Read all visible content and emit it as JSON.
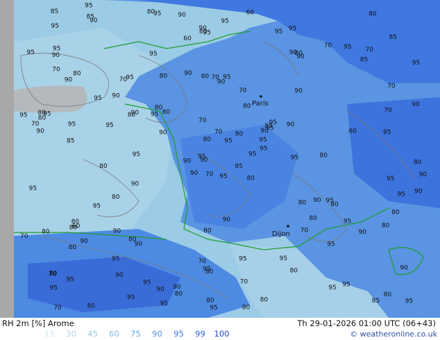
{
  "map": {
    "city": {
      "name": "Paris"
    },
    "city2": {
      "name": "Dijon"
    },
    "contour_labels": [
      "95",
      "90",
      "90",
      "80",
      "90",
      "90",
      "95",
      "95",
      "80",
      "95",
      "90",
      "95",
      "85",
      "95",
      "90",
      "90",
      "80",
      "80",
      "80",
      "90",
      "80",
      "95",
      "90",
      "70",
      "95",
      "80",
      "80",
      "95",
      "90",
      "80",
      "90",
      "95",
      "70",
      "80",
      "95",
      "70",
      "80",
      "85",
      "90",
      "95",
      "60",
      "95",
      "95",
      "70",
      "95",
      "95",
      "95",
      "70",
      "80",
      "95",
      "80",
      "70",
      "95",
      "80",
      "80",
      "95",
      "85",
      "85",
      "95",
      "70",
      "95",
      "95",
      "95",
      "90",
      "95",
      "95",
      "95",
      "60",
      "70",
      "70",
      "80",
      "90",
      "90",
      "80",
      "70",
      "95",
      "95",
      "95",
      "70",
      "70",
      "80",
      "95",
      "95",
      "80",
      "80",
      "95",
      "90",
      "95",
      "80",
      "95",
      "90",
      "90",
      "90",
      "95",
      "95",
      "80",
      "80",
      "95",
      "90",
      "90",
      "80",
      "80",
      "80",
      "70",
      "95",
      "90",
      "95",
      "85",
      "85",
      "90",
      "95",
      "90",
      "90",
      "90",
      "95",
      "80",
      "70",
      "85",
      "90",
      "90",
      "80",
      "80",
      "70",
      "80",
      "80",
      "80",
      "80",
      "80",
      "60",
      "70",
      "60",
      "80",
      "90",
      "95",
      "95",
      "95",
      "90",
      "80",
      "90",
      "80",
      "80",
      "95",
      "90",
      "95",
      "95",
      "95",
      "90",
      "95",
      "95",
      "80",
      "70",
      "70",
      "80",
      "95"
    ]
  },
  "footer": {
    "title": "RH 2m [%] Arome",
    "datetime": "Th 29-01-2026 01:00 UTC (06+43)",
    "credit": "© weatheronline.co.uk",
    "legend": [
      {
        "value": "15",
        "color": "#d0e8f0"
      },
      {
        "value": "30",
        "color": "#b4d6e6"
      },
      {
        "value": "45",
        "color": "#9cc8de"
      },
      {
        "value": "60",
        "color": "#80bde0"
      },
      {
        "value": "75",
        "color": "#6aa8e0"
      },
      {
        "value": "90",
        "color": "#5591e0"
      },
      {
        "value": "95",
        "color": "#3f78e0"
      },
      {
        "value": "99",
        "color": "#2d62d6"
      },
      {
        "value": "100",
        "color": "#1f48c4"
      }
    ]
  }
}
